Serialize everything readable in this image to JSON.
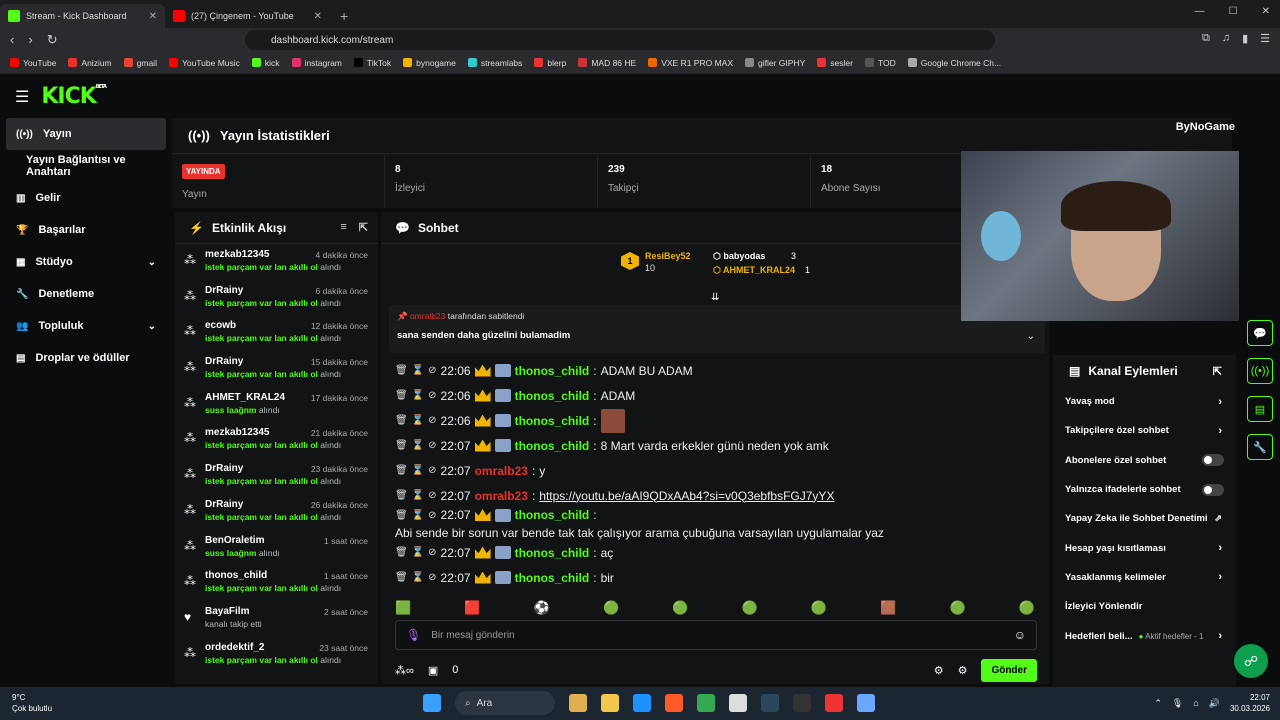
{
  "browser": {
    "tabs": [
      {
        "title": "Stream - Kick Dashboard",
        "active": true
      },
      {
        "title": "(27) Çingenem - YouTube",
        "active": false
      }
    ],
    "url": "dashboard.kick.com/stream",
    "bookmarks": [
      "YouTube",
      "Anizium",
      "gmail",
      "YouTube Music",
      "kick",
      "instagram",
      "TikTok",
      "bynogame",
      "streamlabs",
      "blerp",
      "MAD 86 HE",
      "VXE R1 PRO MAX",
      "gifler GIPHY",
      "sesler",
      "TOD",
      "Google Chrome Ch..."
    ]
  },
  "app": {
    "logo": "KICK",
    "logo_sup": "BETA"
  },
  "sidebar": {
    "items": [
      {
        "label": "Yayın",
        "icon": "broadcast-icon",
        "active": true
      },
      {
        "label": "Yayın Bağlantısı ve Anahtarı",
        "sub": true
      },
      {
        "label": "Gelir",
        "icon": "chart-icon"
      },
      {
        "label": "Başarılar",
        "icon": "trophy-icon"
      },
      {
        "label": "Stüdyo",
        "icon": "studio-icon",
        "chevron": true
      },
      {
        "label": "Denetleme",
        "icon": "wrench-icon"
      },
      {
        "label": "Topluluk",
        "icon": "people-icon",
        "chevron": true
      },
      {
        "label": "Droplar ve ödüller",
        "icon": "gift-icon"
      }
    ]
  },
  "stats": {
    "title": "Yayın İstatistikleri",
    "live_badge": "YAYINDA",
    "live_label": "Yayın",
    "viewers": {
      "value": "8",
      "label": "İzleyici"
    },
    "followers": {
      "value": "239",
      "label": "Takipçi"
    },
    "subs": {
      "value": "18",
      "label": "Abone Sayısı"
    }
  },
  "feed": {
    "title": "Etkinlik Akışı",
    "items": [
      {
        "name": "mezkab12345",
        "time": "4 dakika önce",
        "reward": "istek parçam var lan akıllı ol",
        "suffix": "alındı"
      },
      {
        "name": "DrRainy",
        "time": "6 dakika önce",
        "reward": "istek parçam var lan akıllı ol",
        "suffix": "alındı"
      },
      {
        "name": "ecowb",
        "time": "12 dakika önce",
        "reward": "istek parçam var lan akıllı ol",
        "suffix": "alındı"
      },
      {
        "name": "DrRainy",
        "time": "15 dakika önce",
        "reward": "istek parçam var lan akıllı ol",
        "suffix": "alındı"
      },
      {
        "name": "AHMET_KRAL24",
        "time": "17 dakika önce",
        "reward": "suss laağnm",
        "suffix": "alındı"
      },
      {
        "name": "mezkab12345",
        "time": "21 dakika önce",
        "reward": "istek parçam var lan akıllı ol",
        "suffix": "alındı"
      },
      {
        "name": "DrRainy",
        "time": "23 dakika önce",
        "reward": "istek parçam var lan akıllı ol",
        "suffix": "alındı"
      },
      {
        "name": "DrRainy",
        "time": "26 dakika önce",
        "reward": "istek parçam var lan akıllı ol",
        "suffix": "alındı"
      },
      {
        "name": "BenOraletim",
        "time": "1 saat önce",
        "reward": "suss laağnm",
        "suffix": "alındı"
      },
      {
        "name": "thonos_child",
        "time": "1 saat önce",
        "reward": "istek parçam var lan akıllı ol",
        "suffix": "alındı"
      },
      {
        "name": "BayaFilm",
        "time": "2 saat önce",
        "reward": "",
        "suffix": "kanalı takip etti",
        "heart": true
      },
      {
        "name": "ordedektif_2",
        "time": "23 saat önce",
        "reward": "istek parçam var lan akıllı ol",
        "suffix": "alındı"
      }
    ]
  },
  "chat": {
    "title": "Sohbet",
    "leaders": {
      "first": {
        "name": "ResiBey52",
        "count": "10",
        "rank": "1"
      },
      "second": {
        "name": "babyodas",
        "count": "3"
      },
      "third": {
        "name": "AHMET_KRAL24",
        "count": "1"
      }
    },
    "pinned": {
      "by": "omralb23",
      "by_suffix": "tarafından sabitlendi",
      "message": "sana senden daha güzelini bulamadim"
    },
    "messages": [
      {
        "time": "22:06",
        "user": "thonos_child",
        "color": "g",
        "text": "ADAM BU ADAM",
        "badges": true
      },
      {
        "time": "22:06",
        "user": "thonos_child",
        "color": "g",
        "text": "ADAM",
        "badges": true
      },
      {
        "time": "22:06",
        "user": "thonos_child",
        "color": "g",
        "text": "",
        "badges": true,
        "emote": true
      },
      {
        "time": "22:07",
        "user": "thonos_child",
        "color": "g",
        "text": "8 Mart varda erkekler günü neden yok amk",
        "badges": true
      },
      {
        "time": "22:07",
        "user": "omralb23",
        "color": "r",
        "text": "y",
        "badges": false
      },
      {
        "time": "22:07",
        "user": "omralb23",
        "color": "r",
        "text": "https://youtu.be/aAI9QDxAAb4?si=v0Q3ebfbsFGJ7yYX",
        "badges": false,
        "link": true
      },
      {
        "time": "22:07",
        "user": "thonos_child",
        "color": "g",
        "text": "Abi sende bir sorun var bende tak tak çalışıyor arama çubuğuna varsayılan uygulamalar yaz",
        "badges": true
      },
      {
        "time": "22:07",
        "user": "thonos_child",
        "color": "g",
        "text": "aç",
        "badges": true
      },
      {
        "time": "22:07",
        "user": "thonos_child",
        "color": "g",
        "text": "bir",
        "badges": true
      }
    ],
    "input_placeholder": "Bir mesaj gönderin",
    "points": "0",
    "send_label": "Gönder"
  },
  "overlay": {
    "brand": "ByNoGame"
  },
  "actions": {
    "title": "Kanal Eylemleri",
    "items": [
      {
        "label": "Yavaş mod",
        "type": "arrow"
      },
      {
        "label": "Takipçilere özel sohbet",
        "type": "arrow"
      },
      {
        "label": "Abonelere özel sohbet",
        "type": "toggle",
        "on": false
      },
      {
        "label": "Yalnızca ifadelerle sohbet",
        "type": "toggle",
        "on": false
      },
      {
        "label": "Yapay Zeka ile Sohbet Denetimi",
        "type": "external"
      },
      {
        "label": "Hesap yaşı kısıtlaması",
        "type": "arrow"
      },
      {
        "label": "Yasaklanmış kelimeler",
        "type": "arrow"
      },
      {
        "label": "İzleyici Yönlendir",
        "type": "none"
      },
      {
        "label": "Hedefleri beli...",
        "type": "arrow",
        "sub": "Aktif hedefler - 1"
      }
    ]
  },
  "taskbar": {
    "temp": "9°C",
    "weather": "Çok bulutlu",
    "search": "Ara",
    "time": "22:07",
    "date": "30.03.2026"
  },
  "colors": {
    "accent": "#53fc18",
    "live": "#e7332b",
    "crown": "#f0b400"
  }
}
